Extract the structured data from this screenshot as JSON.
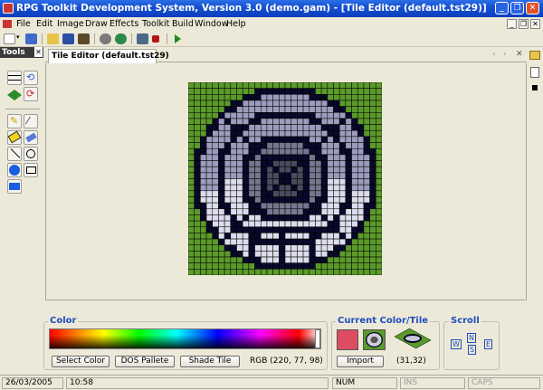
{
  "window": {
    "title": "RPG Toolkit Development System, Version 3.0 (demo.gam) - [Tile Editor  (default.tst29)]",
    "controls": [
      "_",
      "❐",
      "✕"
    ]
  },
  "menu": {
    "items": [
      "File",
      "Edit",
      "Image",
      "Draw",
      "Effects",
      "Toolkit",
      "Build",
      "Window",
      "Help"
    ],
    "mdi_controls": [
      "_",
      "❐",
      "✕"
    ]
  },
  "tools_panel": {
    "title": "Tools",
    "close": "✕"
  },
  "tab": {
    "label": "Tile Editor  (default.tst29)",
    "nav": [
      "‹",
      "›",
      "✕"
    ]
  },
  "tile": {
    "size": [
      32,
      32
    ],
    "colors": {
      "green": "#5b9a2a",
      "dark": "#08082a",
      "gray": "#9c9cbc",
      "light": "#dcdcec",
      "mid": "#76768e",
      "deep": "#4b4b5e"
    }
  },
  "color_panel": {
    "title": "Color",
    "select_color": "Select Color",
    "dos_palette": "DOS Pallete",
    "shade_tile": "Shade Tile",
    "rgb_label": "RGB (220, 77, 98)",
    "current_color": "#dc4d62"
  },
  "current_panel": {
    "title": "Current Color/Tile",
    "import": "Import",
    "coords": "(31,32)"
  },
  "scroll_panel": {
    "title": "Scroll",
    "west": "W",
    "north": "N",
    "south": "S",
    "east": "E"
  },
  "status": {
    "date": "26/03/2005",
    "time": "10:58",
    "num": "NUM",
    "ins": "INS",
    "caps": "CAPS"
  }
}
